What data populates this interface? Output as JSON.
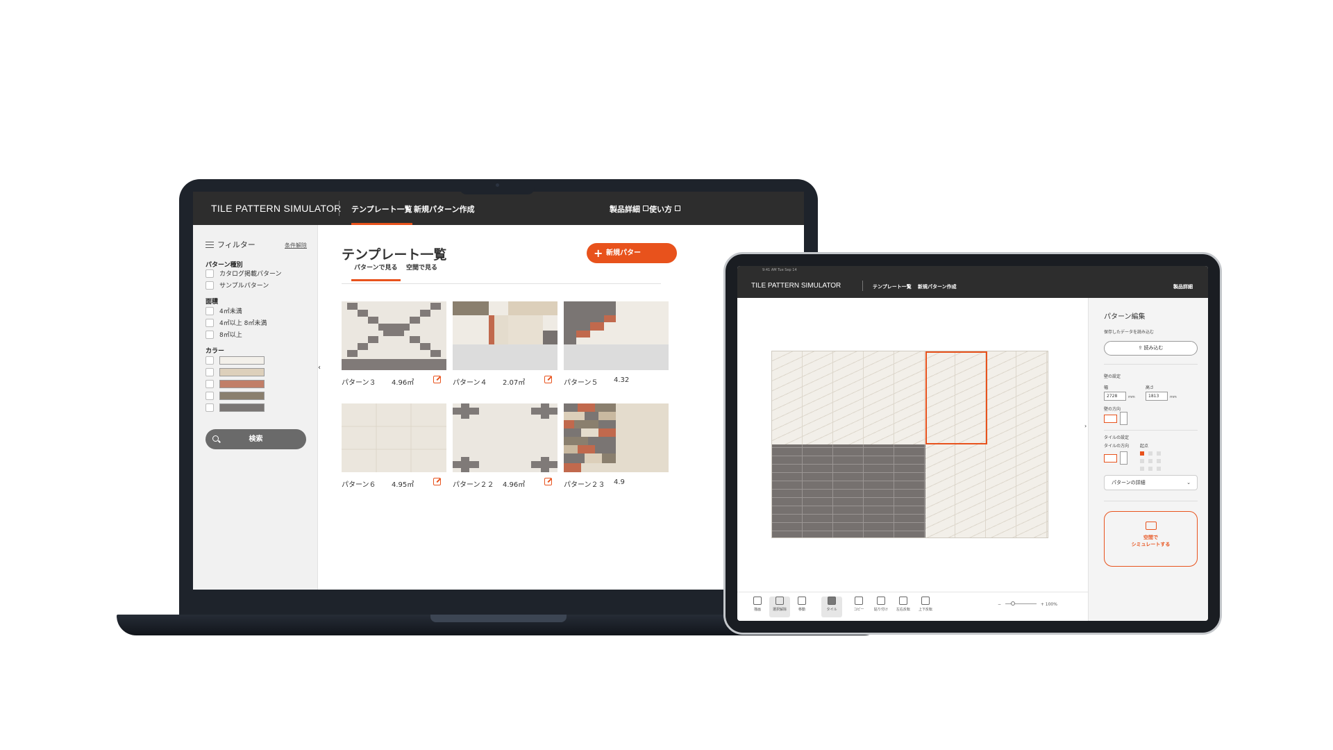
{
  "laptop": {
    "header": {
      "brand": "TILE PATTERN SIMULATOR",
      "nav": [
        {
          "label": "テンプレート一覧",
          "active": true
        },
        {
          "label": "新規パターン作成",
          "active": false
        }
      ],
      "links": [
        "製品詳細",
        "使い方"
      ]
    },
    "sidebar": {
      "filter_title": "フィルター",
      "clear_label": "条件解除",
      "pattern_type": {
        "heading": "パターン種別",
        "options": [
          "カタログ掲載パターン",
          "サンプルパターン"
        ]
      },
      "area": {
        "heading": "面積",
        "options": [
          "4㎡未満",
          "4㎡以上 8㎡未満",
          "8㎡以上"
        ]
      },
      "color": {
        "heading": "カラー",
        "swatches": [
          "#f3f0ea",
          "#ddd0bb",
          "#c17e68",
          "#8a7f6e",
          "#7a7674"
        ]
      },
      "search_label": "検索"
    },
    "main": {
      "title": "テンプレート一覧",
      "new_button": "新規パター",
      "tabs": [
        {
          "label": "パターンで見る",
          "active": true
        },
        {
          "label": "空間で見る",
          "active": false
        }
      ],
      "cards": [
        {
          "name": "パターン３",
          "area": "4.96㎡"
        },
        {
          "name": "パターン４",
          "area": "2.07㎡"
        },
        {
          "name": "パターン５",
          "area": "4.32"
        },
        {
          "name": "パターン６",
          "area": "4.95㎡"
        },
        {
          "name": "パターン２２",
          "area": "4.96㎡"
        },
        {
          "name": "パターン２３",
          "area": "4.9"
        }
      ]
    }
  },
  "tablet": {
    "status": "9:41 AM  Tue Sep 14",
    "header": {
      "brand": "TILE PATTERN SIMULATOR",
      "nav": [
        {
          "label": "テンプレート一覧",
          "active": false
        },
        {
          "label": "新規パターン作成",
          "active": true
        }
      ],
      "link": "製品詳細"
    },
    "toolbar": {
      "tools": [
        "描画",
        "選択解除",
        "移動",
        "タイル",
        "コピー",
        "貼り付け",
        "左右反転",
        "上下反転"
      ],
      "zoom": "100%"
    },
    "panel": {
      "title": "パターン編集",
      "load_label": "保存したデータを読み込む",
      "load_button": "読み込む",
      "wall_settings": "壁の設定",
      "width_label": "幅",
      "width_value": "2728",
      "height_label": "高さ",
      "height_value": "1813",
      "unit": "mm",
      "wall_direction": "壁の方向",
      "tile_settings": "タイルの設定",
      "tile_direction": "タイルの方向",
      "origin": "起点",
      "details_select": "パターンの詳細",
      "simulate_line1": "空間で",
      "simulate_line2": "シミュレートする"
    }
  }
}
